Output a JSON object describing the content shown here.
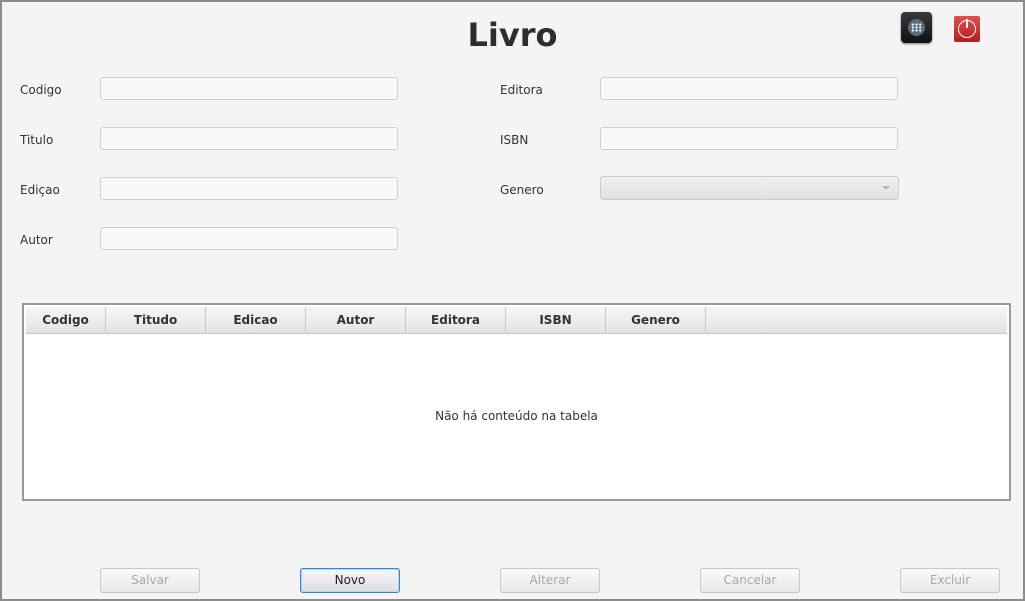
{
  "window": {
    "title": "Livro"
  },
  "toolbar": {
    "menu_icon": "menu-grid-icon",
    "power_icon": "power-icon"
  },
  "form": {
    "codigo": {
      "label": "Codigo",
      "value": ""
    },
    "titulo": {
      "label": "Titulo",
      "value": ""
    },
    "edicao": {
      "label": "Ediçao",
      "value": ""
    },
    "autor": {
      "label": "Autor",
      "value": ""
    },
    "editora": {
      "label": "Editora",
      "value": ""
    },
    "isbn": {
      "label": "ISBN",
      "value": ""
    },
    "genero": {
      "label": "Genero",
      "value": ""
    }
  },
  "table": {
    "columns": [
      "Codigo",
      "Titudo",
      "Edicao",
      "Autor",
      "Editora",
      "ISBN",
      "Genero"
    ],
    "rows": [],
    "empty_message": "Não há conteúdo na tabela"
  },
  "buttons": {
    "salvar": "Salvar",
    "novo": "Novo",
    "alterar": "Alterar",
    "cancelar": "Cancelar",
    "excluir": "Excluir"
  }
}
